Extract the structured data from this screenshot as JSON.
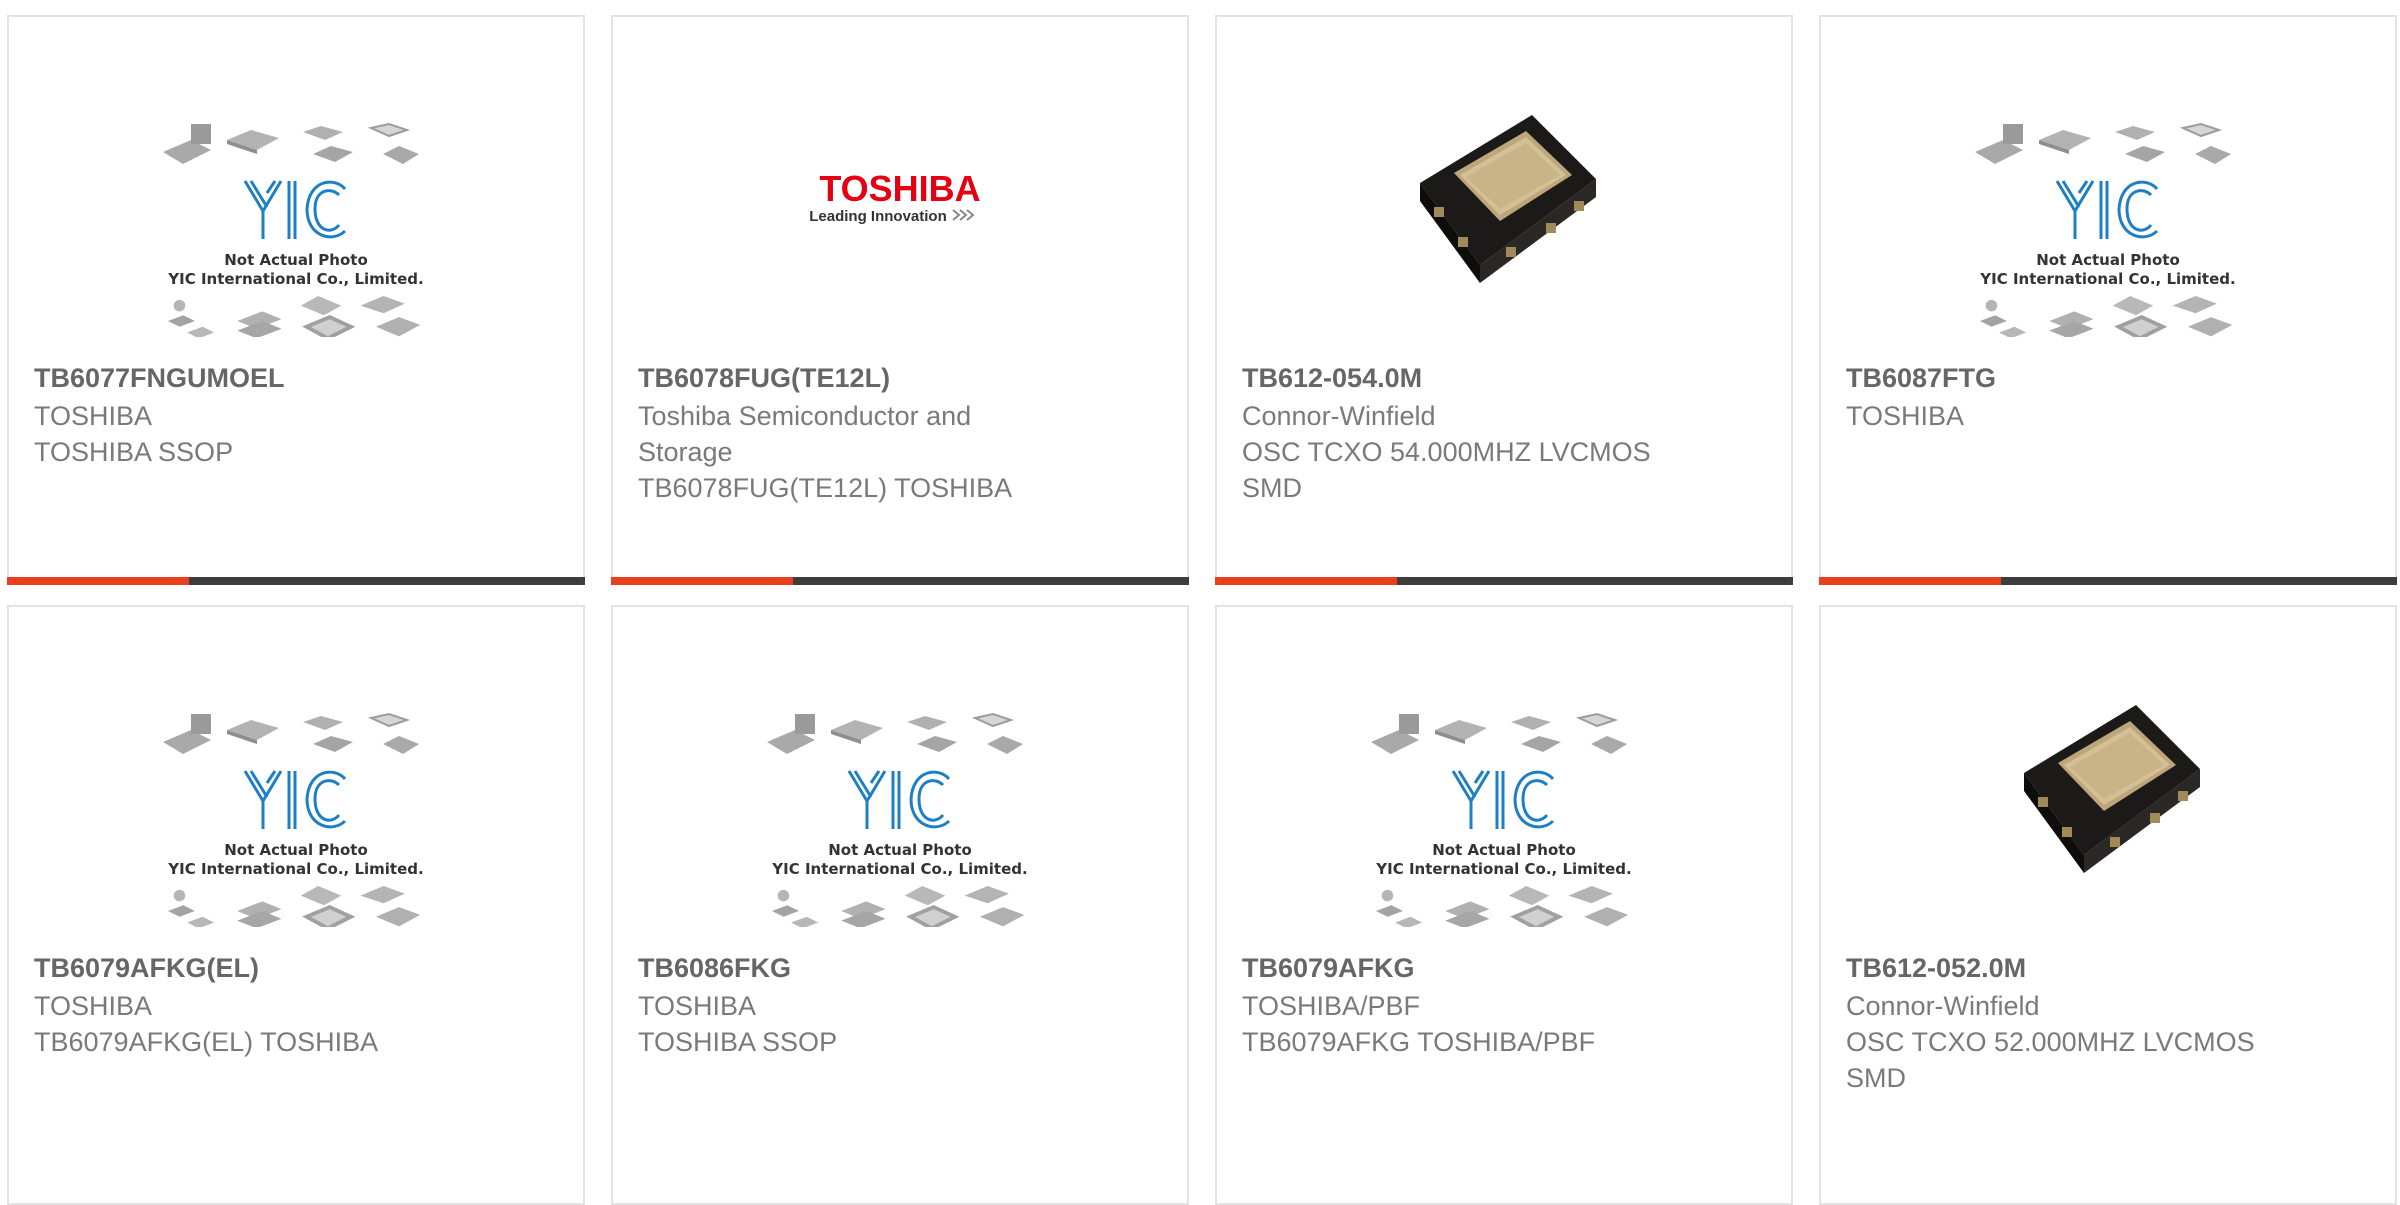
{
  "placeholder": {
    "line1": "Not Actual Photo",
    "line2": "YIC International Co., Limited."
  },
  "toshiba_logo": {
    "brand": "TOSHIBA",
    "tagline": "Leading Innovation"
  },
  "colors": {
    "accent": "#e8401c",
    "bar_dark": "#3d3d3d",
    "border": "#e3e3e3",
    "part_number": "#666666",
    "text": "#7a7a7a",
    "yic_blue": "#1f7fc4",
    "toshiba_red": "#e50012"
  },
  "products": [
    {
      "part_number": "TB6077FNGUMOEL",
      "manufacturer": "TOSHIBA",
      "description": "TOSHIBA SSOP",
      "image": "yic-placeholder"
    },
    {
      "part_number": "TB6078FUG(TE12L)",
      "manufacturer": "Toshiba Semiconductor and Storage",
      "description": "TB6078FUG(TE12L) TOSHIBA",
      "image": "toshiba-logo"
    },
    {
      "part_number": "TB612-054.0M",
      "manufacturer": "Connor-Winfield",
      "description": "OSC TCXO 54.000MHZ LVCMOS SMD",
      "image": "oscillator-photo"
    },
    {
      "part_number": "TB6087FTG",
      "manufacturer": "TOSHIBA",
      "description": "",
      "image": "yic-placeholder"
    },
    {
      "part_number": "TB6079AFKG(EL)",
      "manufacturer": "TOSHIBA",
      "description": "TB6079AFKG(EL) TOSHIBA",
      "image": "yic-placeholder"
    },
    {
      "part_number": "TB6086FKG",
      "manufacturer": "TOSHIBA",
      "description": "TOSHIBA SSOP",
      "image": "yic-placeholder"
    },
    {
      "part_number": "TB6079AFKG",
      "manufacturer": "TOSHIBA/PBF",
      "description": "TB6079AFKG TOSHIBA/PBF",
      "image": "yic-placeholder"
    },
    {
      "part_number": "TB612-052.0M",
      "manufacturer": "Connor-Winfield",
      "description": "OSC TCXO 52.000MHZ LVCMOS SMD",
      "image": "oscillator-photo"
    }
  ]
}
